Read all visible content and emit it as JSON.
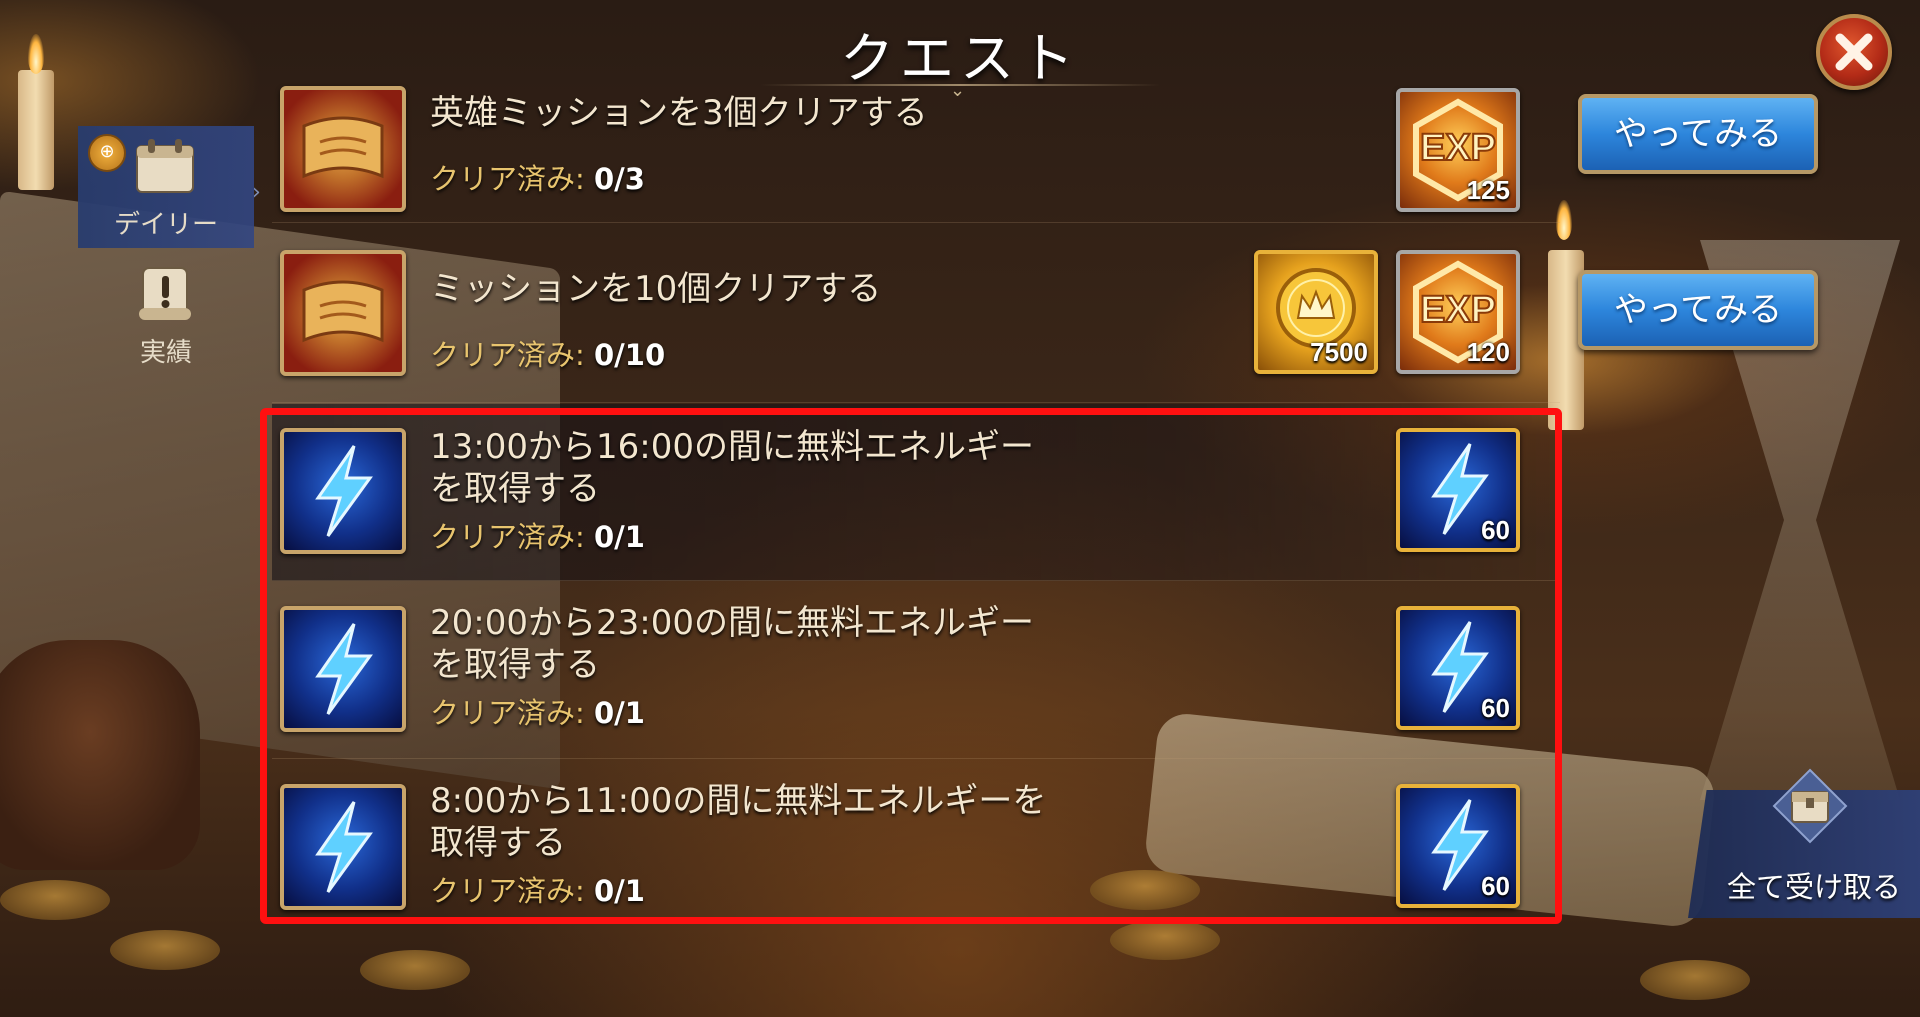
{
  "header": {
    "title": "クエスト"
  },
  "sidebar": {
    "tabs": [
      {
        "label": "デイリー",
        "icon": "calendar-icon",
        "active": true,
        "badge": "gift-icon"
      },
      {
        "label": "実績",
        "icon": "scroll-exclamation-icon",
        "active": false
      }
    ]
  },
  "quests": [
    {
      "icon": "scroll-icon",
      "title": "英雄ミッションを3個クリアする",
      "progress_label": "クリア済み:",
      "progress_value": "0/3",
      "rewards": [
        {
          "type": "exp",
          "icon": "exp-icon",
          "amount": "125"
        }
      ],
      "button": "やってみる"
    },
    {
      "icon": "scroll-icon",
      "title": "ミッションを10個クリアする",
      "progress_label": "クリア済み:",
      "progress_value": "0/10",
      "rewards": [
        {
          "type": "gold",
          "icon": "gold-coin-icon",
          "amount": "7500"
        },
        {
          "type": "exp",
          "icon": "exp-icon",
          "amount": "120"
        }
      ],
      "button": "やってみる"
    },
    {
      "icon": "lightning-icon",
      "title_line1": "13:00から16:00の間に無料エネルギー",
      "title_line2": "を取得する",
      "progress_label": "クリア済み:",
      "progress_value": "0/1",
      "rewards": [
        {
          "type": "energy",
          "icon": "lightning-icon",
          "amount": "60"
        }
      ]
    },
    {
      "icon": "lightning-icon",
      "title_line1": "20:00から23:00の間に無料エネルギー",
      "title_line2": "を取得する",
      "progress_label": "クリア済み:",
      "progress_value": "0/1",
      "rewards": [
        {
          "type": "energy",
          "icon": "lightning-icon",
          "amount": "60"
        }
      ]
    },
    {
      "icon": "lightning-icon",
      "title_line1": "8:00から11:00の間に無料エネルギーを",
      "title_line2": "取得する",
      "progress_label": "クリア済み:",
      "progress_value": "0/1",
      "rewards": [
        {
          "type": "energy",
          "icon": "lightning-icon",
          "amount": "60"
        }
      ]
    }
  ],
  "collect_all": {
    "label": "全て受け取る",
    "icon": "treasure-chest-icon"
  },
  "colors": {
    "highlight": "#ff1010",
    "button": "#2d86dc",
    "progress_label": "#e8c46e"
  }
}
